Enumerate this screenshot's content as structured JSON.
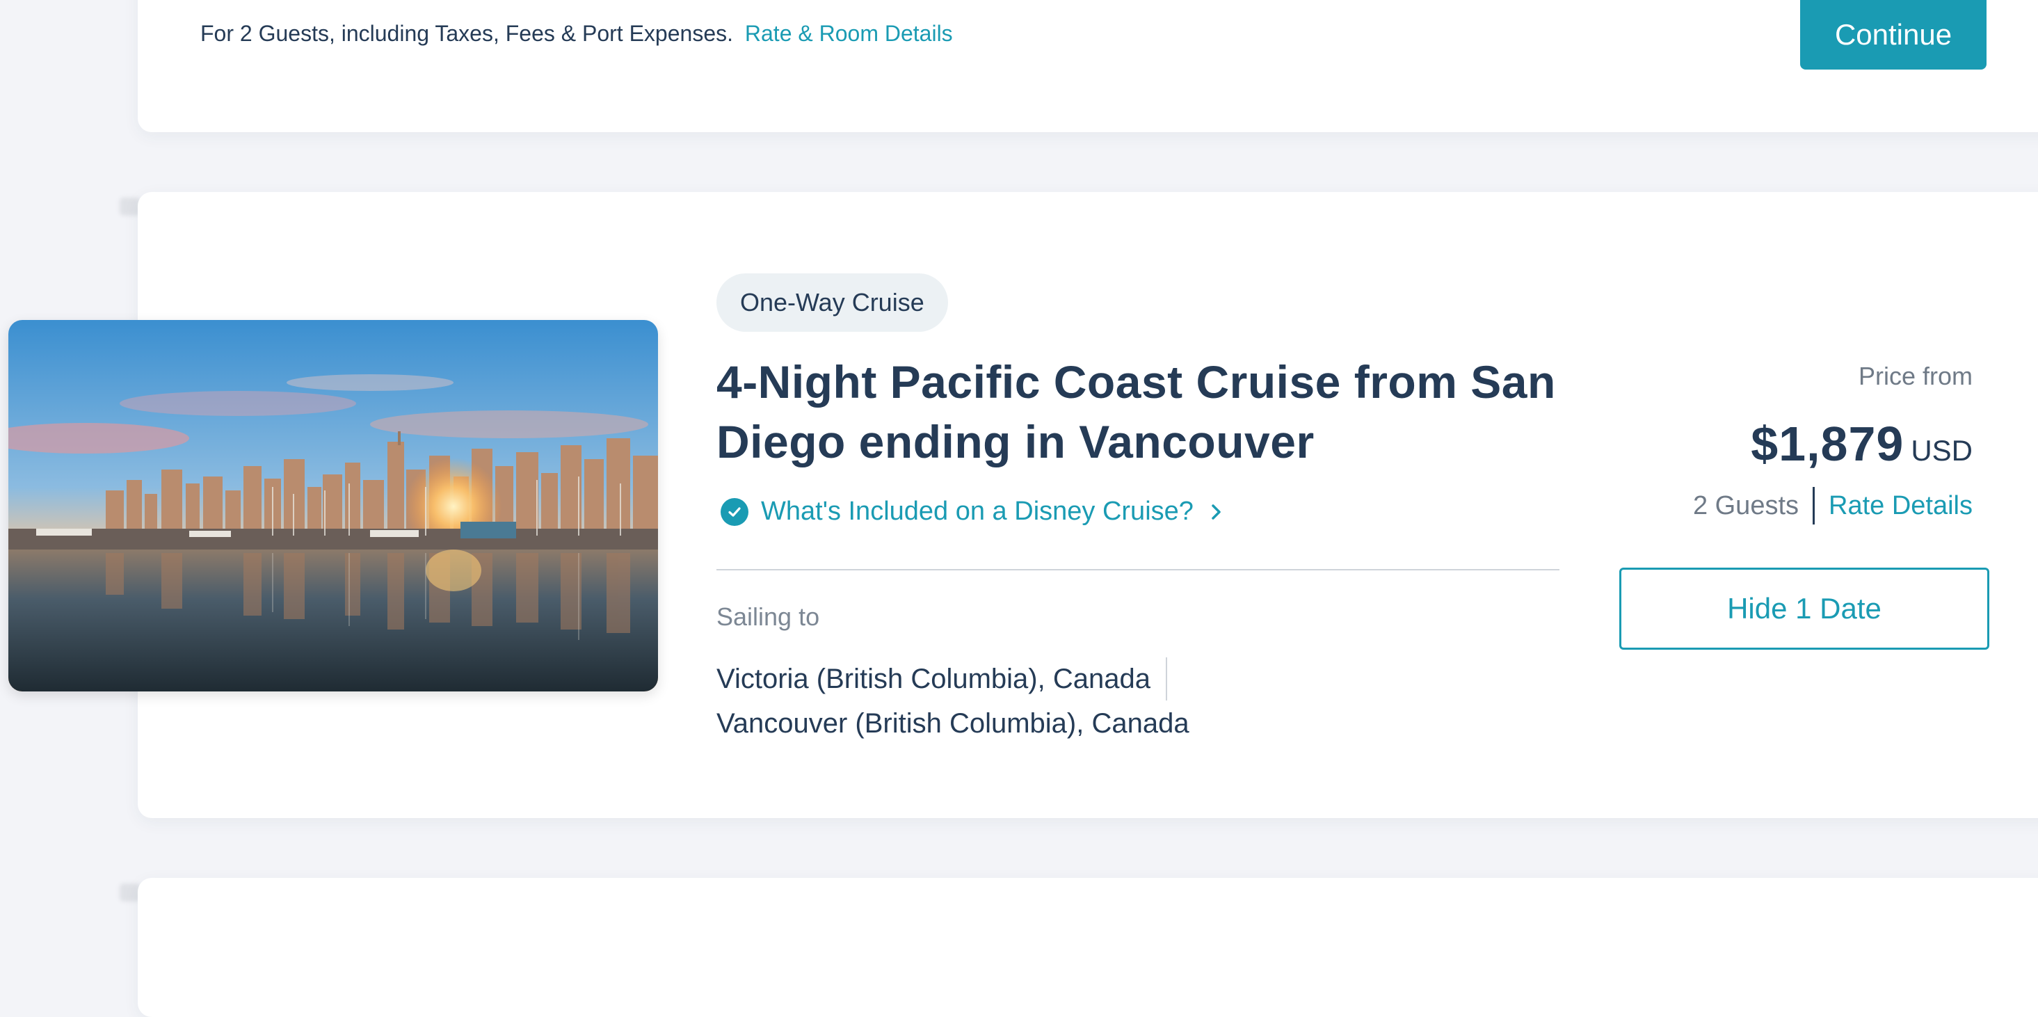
{
  "previous_card": {
    "note": "For 2 Guests, including Taxes, Fees & Port Expenses.",
    "link": "Rate & Room Details",
    "continue_label": "Continue"
  },
  "cruise": {
    "badge": "One-Way Cruise",
    "title": "4-Night Pacific Coast Cruise from San Diego ending in Vancouver",
    "included_link": "What's Included on a Disney Cruise?",
    "sailing_label": "Sailing to",
    "ports": [
      "Victoria (British Columbia), Canada",
      "Vancouver (British Columbia), Canada"
    ],
    "price": {
      "from_label": "Price from",
      "amount": "$1,879",
      "currency": "USD",
      "guests": "2 Guests",
      "rate_link": "Rate Details"
    },
    "hide_button": "Hide 1 Date",
    "image_alt": "Vancouver skyline at sunset reflected over the harbor"
  },
  "colors": {
    "accent": "#1a9bb3",
    "text": "#253b56",
    "muted": "#6f7a87",
    "background": "#f3f4f8"
  }
}
